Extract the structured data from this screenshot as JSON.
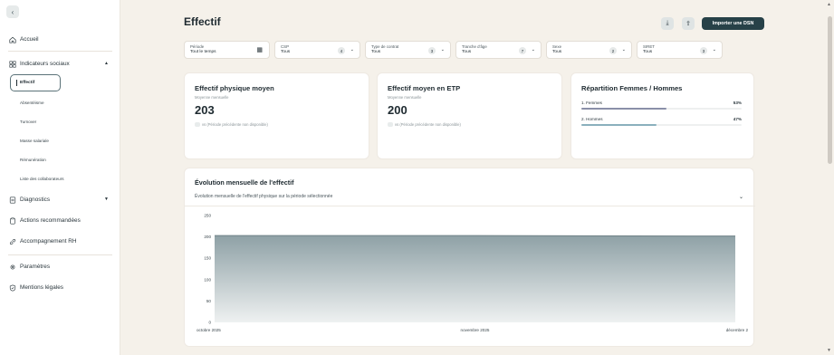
{
  "sidebar": {
    "collapse_icon": "chevron-left-icon",
    "items": [
      {
        "label": "Accueil",
        "icon": "home-icon"
      },
      {
        "label": "Indicateurs sociaux",
        "icon": "grid-icon"
      },
      {
        "label": "Diagnostics",
        "icon": "document-icon"
      },
      {
        "label": "Actions recommandées",
        "icon": "clipboard-icon"
      },
      {
        "label": "Accompagnement RH",
        "icon": "link-icon"
      },
      {
        "label": "Paramètres",
        "icon": "gear-icon"
      },
      {
        "label": "Mentions légales",
        "icon": "shield-icon"
      }
    ],
    "sub_items": [
      "Effectif",
      "Absentéisme",
      "Turnover",
      "Masse salariale",
      "Rémunération",
      "Liste des collaborateurs"
    ]
  },
  "header": {
    "title": "Effectif",
    "download_icon": "download-icon",
    "share_icon": "share-icon",
    "import_label": "Importer une DSN"
  },
  "filters": [
    {
      "label": "Période",
      "value": "Tout le temps",
      "icon": "calendar-icon"
    },
    {
      "label": "CSP",
      "value": "Tous",
      "count": "4"
    },
    {
      "label": "Type de contrat",
      "value": "Tous",
      "count": "3"
    },
    {
      "label": "Tranche d'âge",
      "value": "Tous",
      "count": "7"
    },
    {
      "label": "Sexe",
      "value": "Tous",
      "count": "2"
    },
    {
      "label": "SIRET",
      "value": "Tous",
      "count": "3"
    }
  ],
  "cards": {
    "physique": {
      "title": "Effectif physique moyen",
      "subtitle": "Moyenne mensuelle",
      "value": "203",
      "note": "vs (Période précédente non disponible)"
    },
    "etp": {
      "title": "Effectif moyen en ETP",
      "subtitle": "Moyenne mensuelle",
      "value": "200",
      "note": "vs (Période précédente non disponible)"
    },
    "repartition": {
      "title": "Répartition Femmes / Hommes",
      "rows": [
        {
          "label": "1. Femmes",
          "pct": "53%",
          "value": 0.53,
          "color": "#8a8fa8"
        },
        {
          "label": "2. Hommes",
          "pct": "47%",
          "value": 0.47,
          "color": "#8ab0bd"
        }
      ]
    }
  },
  "chart": {
    "title": "Évolution mensuelle de l'effectif",
    "subtitle": "Évolution mensuelle de l'effectif physique sur la période sélectionnée"
  },
  "chart_data": {
    "type": "area",
    "x": [
      "octobre 2025",
      "novembre 2025",
      "décembre 2025"
    ],
    "x_tick_labels": [
      "octobre 2025",
      "novembre 2025",
      "décembre 2"
    ],
    "series": [
      {
        "values": [
          203,
          203,
          202
        ]
      }
    ],
    "yticks": [
      0,
      50,
      100,
      150,
      200,
      250
    ],
    "ylim": [
      0,
      250
    ],
    "grid": false,
    "colors": {
      "line": "#6f8186",
      "fill_top": "#8fa1a6",
      "fill_bottom": "#eef1f1"
    }
  }
}
